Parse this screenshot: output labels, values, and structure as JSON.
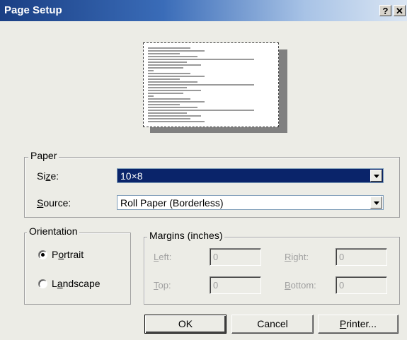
{
  "window": {
    "title": "Page Setup",
    "help_glyph": "?",
    "close_glyph": "✕"
  },
  "paper": {
    "legend": "Paper",
    "size_label_pre": "Si",
    "size_label_u": "z",
    "size_label_post": "e:",
    "size_value": "10×8",
    "source_label_u": "S",
    "source_label_post": "ource:",
    "source_value": "Roll Paper (Borderless)"
  },
  "orientation": {
    "legend": "Orientation",
    "portrait_pre": "P",
    "portrait_u": "o",
    "portrait_post": "rtrait",
    "landscape_pre": "L",
    "landscape_u": "a",
    "landscape_post": "ndscape",
    "selected": "Portrait"
  },
  "margins": {
    "legend": "Margins (inches)",
    "left_u": "L",
    "left_post": "eft:",
    "left_value": "0",
    "right_u": "R",
    "right_post": "ight:",
    "right_value": "0",
    "top_u": "T",
    "top_post": "op:",
    "top_value": "0",
    "bottom_u": "B",
    "bottom_post": "ottom:",
    "bottom_value": "0"
  },
  "buttons": {
    "ok": "OK",
    "cancel": "Cancel",
    "printer_u": "P",
    "printer_post": "rinter..."
  },
  "colors": {
    "title_active": "#1a3f84",
    "selection": "#0a246a",
    "dialog_face": "#ecece6"
  }
}
